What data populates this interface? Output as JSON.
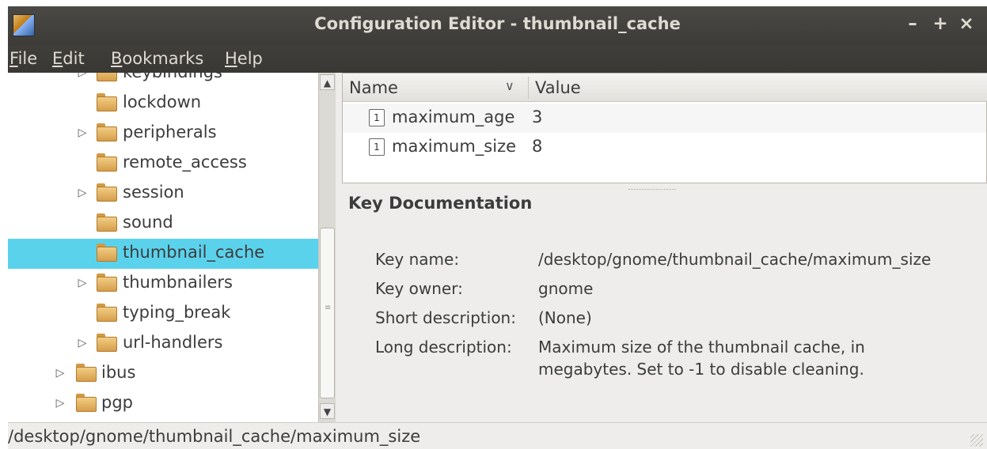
{
  "window": {
    "title": "Configuration Editor - thumbnail_cache",
    "buttons": {
      "minimize": "–",
      "maximize": "+",
      "close": "×"
    }
  },
  "menubar": [
    {
      "underline": "F",
      "rest": "ile"
    },
    {
      "underline": "E",
      "rest": "dit"
    },
    {
      "underline": "B",
      "rest": "ookmarks"
    },
    {
      "underline": "H",
      "rest": "elp"
    }
  ],
  "tree": [
    {
      "label": "keybindings",
      "expandable": true
    },
    {
      "label": "lockdown",
      "expandable": false
    },
    {
      "label": "peripherals",
      "expandable": true
    },
    {
      "label": "remote_access",
      "expandable": false
    },
    {
      "label": "session",
      "expandable": true
    },
    {
      "label": "sound",
      "expandable": false
    },
    {
      "label": "thumbnail_cache",
      "expandable": false,
      "selected": true
    },
    {
      "label": "thumbnailers",
      "expandable": true
    },
    {
      "label": "typing_break",
      "expandable": false
    },
    {
      "label": "url-handlers",
      "expandable": true
    },
    {
      "label": "ibus",
      "expandable": true
    },
    {
      "label": "pgp",
      "expandable": true
    }
  ],
  "key_list": {
    "columns": {
      "name": "Name",
      "value": "Value"
    },
    "rows": [
      {
        "name": "maximum_age",
        "value": "3",
        "type_icon": "1"
      },
      {
        "name": "maximum_size",
        "value": "8",
        "type_icon": "1"
      }
    ]
  },
  "doc": {
    "title": "Key Documentation",
    "key_name_label": "Key name:",
    "key_name": "/desktop/gnome/thumbnail_cache/maximum_size",
    "key_owner_label": "Key owner:",
    "key_owner": "gnome",
    "short_desc_label": "Short description:",
    "short_desc": "(None)",
    "long_desc_label": "Long description:",
    "long_desc_line1": "Maximum size of the thumbnail cache, in",
    "long_desc_line2": "megabytes. Set to -1 to disable cleaning."
  },
  "status": "/desktop/gnome/thumbnail_cache/maximum_size",
  "colors": {
    "selection": "#5bd2ec",
    "titlebar": "#3c3b37",
    "folder": "#e4b465"
  }
}
